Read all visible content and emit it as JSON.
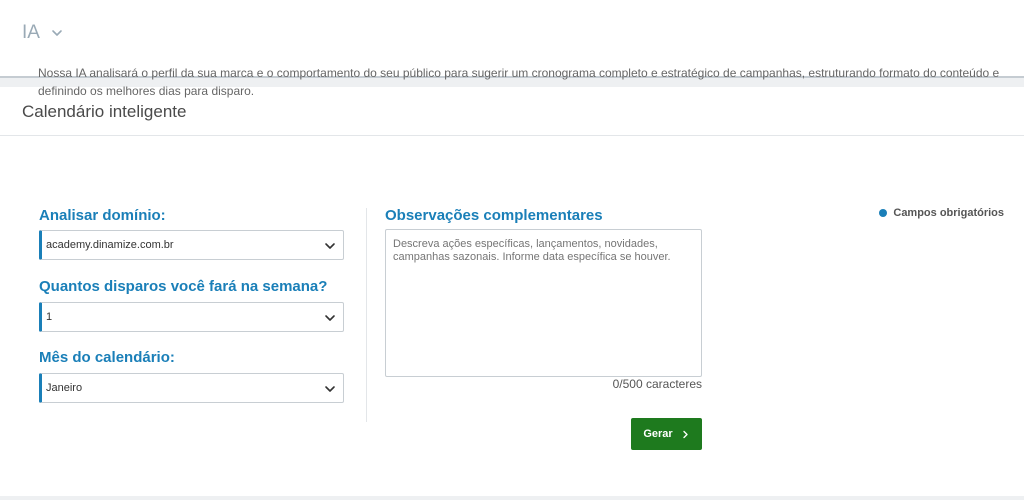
{
  "header": {
    "brand_label": "IA",
    "brand_icon": "chevron-down-icon"
  },
  "panel": {
    "title": "Calendário inteligente",
    "description": "Nossa IA analisará o perfil da sua marca e o comportamento do seu público para sugerir um cronograma completo e estratégico de campanhas, estruturando formato do conteúdo e definindo os melhores dias para disparo."
  },
  "form": {
    "domain": {
      "label": "Analisar domínio:",
      "value": "academy.dinamize.com.br"
    },
    "sends_per_week": {
      "label": "Quantos disparos você fará na semana?",
      "value": "1"
    },
    "month": {
      "label": "Mês do calendário:",
      "value": "Janeiro"
    },
    "notes": {
      "label": "Observações complementares",
      "placeholder": "Descreva ações específicas, lançamentos, novidades, campanhas sazonais. Informe data específica se houver.",
      "value": "",
      "char_count": "0/500 caracteres"
    },
    "required_legend": "Campos obrigatórios",
    "submit_label": "Gerar"
  },
  "colors": {
    "accent": "#1a7fb8",
    "submit": "#1e7a1e",
    "muted_brand": "#9aaab6"
  }
}
